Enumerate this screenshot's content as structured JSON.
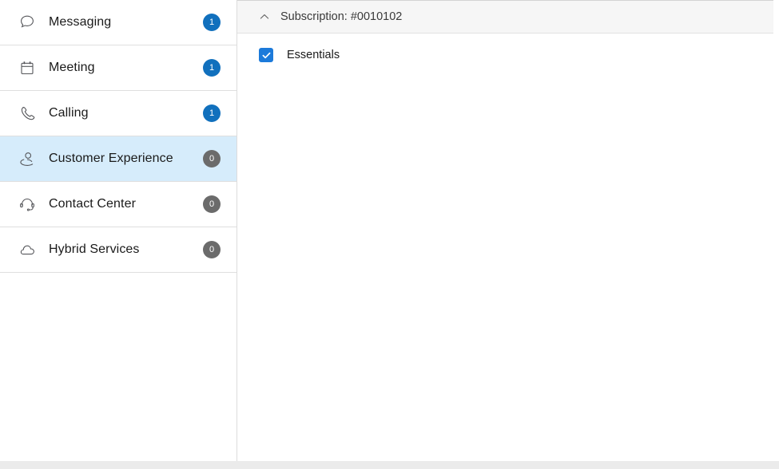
{
  "sidebar": {
    "items": [
      {
        "label": "Messaging",
        "icon": "message-bubble-icon",
        "badge": "1",
        "badge_style": "blue",
        "selected": false
      },
      {
        "label": "Meeting",
        "icon": "calendar-icon",
        "badge": "1",
        "badge_style": "blue",
        "selected": false
      },
      {
        "label": "Calling",
        "icon": "phone-handset-icon",
        "badge": "1",
        "badge_style": "blue",
        "selected": false
      },
      {
        "label": "Customer Experience",
        "icon": "user-person-icon",
        "badge": "0",
        "badge_style": "gray",
        "selected": true
      },
      {
        "label": "Contact Center",
        "icon": "headset-icon",
        "badge": "0",
        "badge_style": "gray",
        "selected": false
      },
      {
        "label": "Hybrid Services",
        "icon": "cloud-icon",
        "badge": "0",
        "badge_style": "gray",
        "selected": false
      }
    ]
  },
  "detail": {
    "header": {
      "title": "Subscription: #0010102",
      "collapse_icon": "chevron-up-icon"
    },
    "options": [
      {
        "label": "Essentials",
        "checked": true
      }
    ]
  },
  "colors": {
    "badge_blue": "#1170bd",
    "badge_gray": "#6b6b6b",
    "selected_row": "#d6ecfb",
    "checkbox_blue": "#1c7ada",
    "header_background": "#f6f6f6"
  }
}
